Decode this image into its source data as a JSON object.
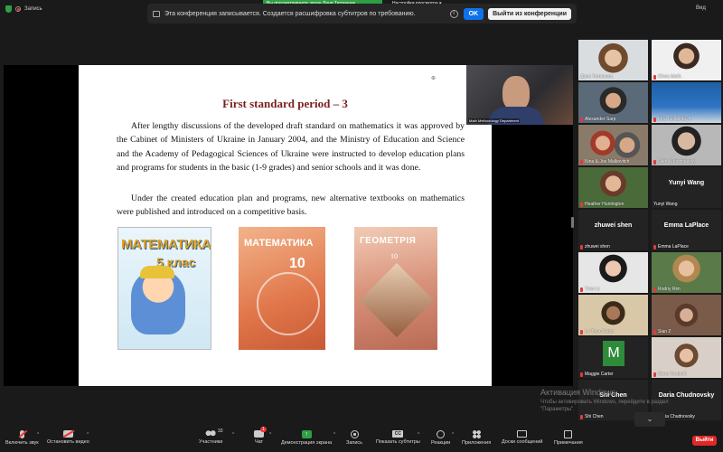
{
  "topbar": {
    "recording_label": "Запись",
    "viewing_label": "Вы просматриваете экран Даня Тютюнник",
    "view_options_label": "Настройки просмотра",
    "view_label": "Вид"
  },
  "banner": {
    "message": "Эта конференция записывается. Создается расшифровка субтитров по требованию.",
    "info": "i",
    "ok_label": "OK",
    "leave_label": "Выйти из конференции"
  },
  "slide": {
    "title": "First standard period – 3",
    "paragraph1": "After lengthy discussions of the developed draft standard on mathematics it was approved by the Cabinet of Ministers of Ukraine in January 2004, and the Ministry of Education and Science and the Academy of Pedagogical Sciences of Ukraine were instructed to develop education plans and programs for students in the basic (1-9 grades) and senior schools and it was done.",
    "paragraph2": "Under the created education plan and programs, new alternative textbooks on mathematics were published and introduced on a competitive basis.",
    "book1_title": "МАТЕМАТИКА",
    "book1_grade": "5 клас",
    "book2_title": "МАТЕМАТИКА",
    "book2_grade": "10",
    "book3_title": "ГЕОМЕТРІЯ",
    "book3_grade": "10"
  },
  "presenter": {
    "label": "Math Methodology Department"
  },
  "participants": [
    {
      "name": "Даня Тютюнник",
      "muted": false,
      "active": true
    },
    {
      "name": "Olivia Malik",
      "muted": true
    },
    {
      "name": "Alexander Sarp",
      "muted": true
    },
    {
      "name": "Irina Goldshteyn",
      "muted": true
    },
    {
      "name": "Nina & Joe Malkovitch",
      "muted": true
    },
    {
      "name": "Oleh Kuhochevsky",
      "muted": true
    },
    {
      "name": "Heather Huntington",
      "muted": true
    },
    {
      "name": "Yunyi Wang",
      "muted": false
    },
    {
      "name": "zhuwei shen",
      "muted": true
    },
    {
      "name": "Emma LaPlace",
      "muted": true
    },
    {
      "name": "Yiran Li",
      "muted": true
    },
    {
      "name": "Rodriy Rim",
      "muted": true
    },
    {
      "name": "La Toya Caton",
      "muted": true
    },
    {
      "name": "Sian Z",
      "muted": true
    },
    {
      "name": "Maggie Carter",
      "muted": true
    },
    {
      "name": "Clara Kodamil",
      "muted": true
    },
    {
      "name": "Shi Chen",
      "muted": true
    },
    {
      "name": "Daria Chudnovsky",
      "muted": true
    }
  ],
  "participant_big_labels": {
    "yunyi": "Yunyi Wang",
    "zhuwei": "zhuwei shen",
    "emma": "Emma LaPlace",
    "shi": "Shi Chen",
    "daria": "Daria Chudnovsky",
    "maggie_initial": "M"
  },
  "watermark": {
    "line1": "Активация Windows",
    "line2": "Чтобы активировать Windows, перейдите в раздел",
    "line3": "\"Параметры\"."
  },
  "toolbar": {
    "mute_label": "Включить звук",
    "video_label": "Остановить видео",
    "participants_label": "Участники",
    "participants_count": "33",
    "chat_label": "Чат",
    "chat_badge": "1",
    "share_label": "Демонстрация экрана",
    "record_label": "Запись",
    "subtitles_label": "Показать субтитры",
    "reactions_label": "Реакции",
    "apps_label": "Приложения",
    "boards_label": "Доски сообщений",
    "notes_label": "Примечания",
    "leave_label": "Выйти",
    "cc_text": "CC"
  },
  "colors": {
    "accent_green": "#2ea043",
    "zoom_blue": "#0e72ed",
    "leave_red": "#e02828",
    "slide_title": "#7a1f1f",
    "active_speaker": "#f2d23c"
  },
  "icons": [
    "shield-icon",
    "record-icon",
    "info-icon",
    "mic-muted-icon",
    "camera-icon",
    "people-icon",
    "chat-icon",
    "share-screen-icon",
    "record-button-icon",
    "captions-icon",
    "reactions-icon",
    "apps-icon",
    "whiteboard-icon",
    "notes-icon",
    "chevron-down-icon"
  ]
}
